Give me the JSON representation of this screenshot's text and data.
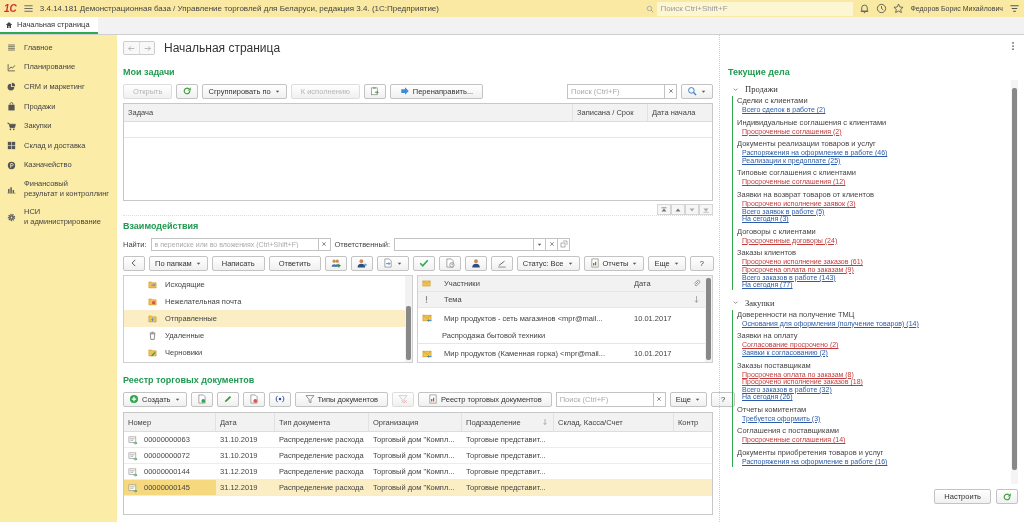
{
  "title_bar": {
    "logo": "1С",
    "title": "3.4.14.181 Демонстрационная база / Управление торговлей для Беларуси, редакция 3.4.  (1С:Предприятие)",
    "search_placeholder": "Поиск Ctrl+Shift+F",
    "user": "Федоров Борис Михайлович"
  },
  "open_tabs": [
    {
      "label": "Начальная страница",
      "selected": true
    }
  ],
  "sidebar": {
    "items": [
      {
        "lines": [
          "Главное"
        ]
      },
      {
        "lines": [
          "Планирование"
        ]
      },
      {
        "lines": [
          "CRM и маркетинг"
        ]
      },
      {
        "lines": [
          "Продажи"
        ]
      },
      {
        "lines": [
          "Закупки"
        ]
      },
      {
        "lines": [
          "Склад и доставка"
        ]
      },
      {
        "lines": [
          "Казначейство"
        ]
      },
      {
        "lines": [
          "Финансовый",
          "результат и контроллинг"
        ]
      },
      {
        "lines": [
          "НСИ",
          "и администрирование"
        ]
      }
    ]
  },
  "page": {
    "title": "Начальная страница"
  },
  "tasks": {
    "title": "Мои задачи",
    "toolbar": {
      "left": [
        {
          "kind": "button",
          "label": "Открыть",
          "disabled": true
        },
        {
          "kind": "icon",
          "disabled": false
        },
        {
          "kind": "menu",
          "label": "Сгруппировать по",
          "disabled": false
        },
        {
          "kind": "button",
          "label": "К исполнению",
          "disabled": true
        },
        {
          "kind": "icon",
          "disabled": false
        },
        {
          "kind": "icon_button",
          "label": "Перенаправить...",
          "disabled": false
        }
      ],
      "right": [
        {
          "kind": "search",
          "placeholder": "Поиск (Ctrl+F)"
        },
        {
          "kind": "icon_menu",
          "disabled": false
        }
      ]
    },
    "columns": [
      "Задача",
      "Записана / Срок",
      "Дата начала"
    ]
  },
  "interactions": {
    "title": "Взаимодействия",
    "find_label": "Найти:",
    "find_placeholder": "в переписке или во вложениях (Ctrl+Shift+F)",
    "responsible_label": "Ответственный:",
    "toolbar": {
      "left": [
        {
          "kind": "icon",
          "disabled": false
        },
        {
          "kind": "menu",
          "label": "По папкам",
          "disabled": false
        },
        {
          "kind": "button",
          "label": "Написать",
          "disabled": false
        },
        {
          "kind": "button",
          "label": "Ответить",
          "disabled": false
        },
        {
          "kind": "icon",
          "disabled": false
        },
        {
          "kind": "icon",
          "disabled": false
        },
        {
          "kind": "icon_menu",
          "disabled": false
        },
        {
          "kind": "icon",
          "disabled": false
        },
        {
          "kind": "icon",
          "disabled": false
        },
        {
          "kind": "icon",
          "disabled": false
        },
        {
          "kind": "icon",
          "disabled": false
        },
        {
          "kind": "menu",
          "label": "Статус: Все",
          "disabled": false
        },
        {
          "kind": "icon_menu_button",
          "label": "Отчеты",
          "disabled": false
        }
      ],
      "right": [
        {
          "kind": "menu",
          "label": "Еще",
          "disabled": false
        },
        {
          "kind": "button",
          "label": "?",
          "disabled": false
        }
      ]
    },
    "folders": [
      {
        "label": "Исходящие",
        "selected": false
      },
      {
        "label": "Нежелательная почта",
        "selected": false
      },
      {
        "label": "Отправленные",
        "selected": true
      },
      {
        "label": "Удаленные",
        "selected": false
      },
      {
        "label": "Черновики",
        "selected": false
      }
    ],
    "mail": {
      "columns": [
        "Участники",
        "Дата"
      ],
      "subject_column": "Тема",
      "rows": [
        {
          "participants": "Мир продуктов - сеть магазинов <mpr@mail...",
          "date": "10.01.2017",
          "subject": "Распродажа бытовой техники"
        },
        {
          "participants": "Мир продуктов (Каменная горка) <mpr@mail...",
          "date": "10.01.2017"
        }
      ]
    }
  },
  "registry": {
    "title": "Реестр торговых документов",
    "toolbar": {
      "left": [
        {
          "kind": "icon_menu_button",
          "label": "Создать",
          "disabled": false
        },
        {
          "kind": "icon",
          "disabled": false
        },
        {
          "kind": "icon",
          "disabled": false
        },
        {
          "kind": "icon",
          "disabled": false
        },
        {
          "kind": "icon",
          "disabled": false
        },
        {
          "kind": "icon_button",
          "label": "Типы документов",
          "disabled": false
        },
        {
          "kind": "icon",
          "disabled": true
        },
        {
          "kind": "icon_button",
          "label": "Реестр торговых документов",
          "disabled": false
        }
      ],
      "right": [
        {
          "kind": "search",
          "placeholder": "Поиск (Ctrl+F)"
        },
        {
          "kind": "menu",
          "label": "Еще",
          "disabled": false
        },
        {
          "kind": "button",
          "label": "?",
          "disabled": false
        }
      ]
    },
    "columns": [
      "Номер",
      "Дата",
      "Тип документа",
      "Организация",
      "Подразделение",
      "Склад, Касса/Счет",
      "Контр"
    ],
    "rows": [
      {
        "cells": [
          "00000000063",
          "31.10.2019",
          "Распределение расхода",
          "Торговый дом \"Компл...",
          "Торговые представит...",
          "",
          ""
        ],
        "selected": false
      },
      {
        "cells": [
          "00000000072",
          "31.10.2019",
          "Распределение расхода",
          "Торговый дом \"Компл...",
          "Торговые представит...",
          "",
          ""
        ],
        "selected": false
      },
      {
        "cells": [
          "00000000144",
          "31.12.2019",
          "Распределение расхода",
          "Торговый дом \"Компл...",
          "Торговые представит...",
          "",
          ""
        ],
        "selected": false
      },
      {
        "cells": [
          "00000000145",
          "31.12.2019",
          "Распределение расхода",
          "Торговый дом \"Компл...",
          "Торговые представит...",
          "",
          ""
        ],
        "selected": true
      }
    ]
  },
  "current_tasks": {
    "title": "Текущие дела",
    "groups": [
      {
        "label": "Продажи",
        "expanded": true,
        "items": [
          {
            "title": "Сделки с клиентами",
            "links": [
              {
                "text": "Всего сделок в работе (2)",
                "alert": false
              }
            ]
          },
          {
            "title": "Индивидуальные соглашения с клиентами",
            "links": [
              {
                "text": "Просроченные соглашения (2)",
                "alert": true
              }
            ]
          },
          {
            "title": "Документы реализации товаров и услуг",
            "links": [
              {
                "text": "Распоряжения на оформление в работе (46)",
                "alert": false
              },
              {
                "text": "Реализации к предоплате (25)",
                "alert": false
              }
            ]
          },
          {
            "title": "Типовые соглашения с клиентами",
            "links": [
              {
                "text": "Просроченные соглашения (12)",
                "alert": true
              }
            ]
          },
          {
            "title": "Заявки на возврат товаров от клиентов",
            "links": [
              {
                "text": "Просрочено исполнение заявок (3)",
                "alert": true
              },
              {
                "text": "Всего заявок в работе (5)",
                "alert": false
              },
              {
                "text": "На сегодня (3)",
                "alert": false
              }
            ]
          },
          {
            "title": "Договоры с клиентами",
            "links": [
              {
                "text": "Просроченные договоры (24)",
                "alert": true
              }
            ]
          },
          {
            "title": "Заказы клиентов",
            "links": [
              {
                "text": "Просрочено исполнение заказов (61)",
                "alert": true
              },
              {
                "text": "Просрочена оплата по заказам (9)",
                "alert": true
              },
              {
                "text": "Всего заказов в работе (143)",
                "alert": false
              },
              {
                "text": "На сегодня (77)",
                "alert": false
              }
            ]
          }
        ]
      },
      {
        "label": "Закупки",
        "expanded": true,
        "items": [
          {
            "title": "Доверенности на получение ТМЦ",
            "links": [
              {
                "text": "Основания для оформления (получение товаров) (14)",
                "alert": false
              }
            ]
          },
          {
            "title": "Заявки на оплату",
            "links": [
              {
                "text": "Согласование просрочено (2)",
                "alert": true
              },
              {
                "text": "Заявки к согласованию (2)",
                "alert": false
              }
            ]
          },
          {
            "title": "Заказы поставщикам",
            "links": [
              {
                "text": "Просрочена оплата по заказам (8)",
                "alert": true
              },
              {
                "text": "Просрочено исполнение заказов (18)",
                "alert": true
              },
              {
                "text": "Всего заказов в работе (32)",
                "alert": false
              },
              {
                "text": "На сегодня (26)",
                "alert": false
              }
            ]
          },
          {
            "title": "Отчеты комитентам",
            "links": [
              {
                "text": "Требуется оформить (3)",
                "alert": false
              }
            ]
          },
          {
            "title": "Соглашения с поставщиками",
            "links": [
              {
                "text": "Просроченные соглашения (14)",
                "alert": true
              }
            ]
          },
          {
            "title": "Документы приобретения товаров и услуг",
            "links": [
              {
                "text": "Распоряжения на оформление в работе (16)",
                "alert": false
              }
            ]
          }
        ]
      }
    ],
    "settings_button": "Настроить"
  }
}
